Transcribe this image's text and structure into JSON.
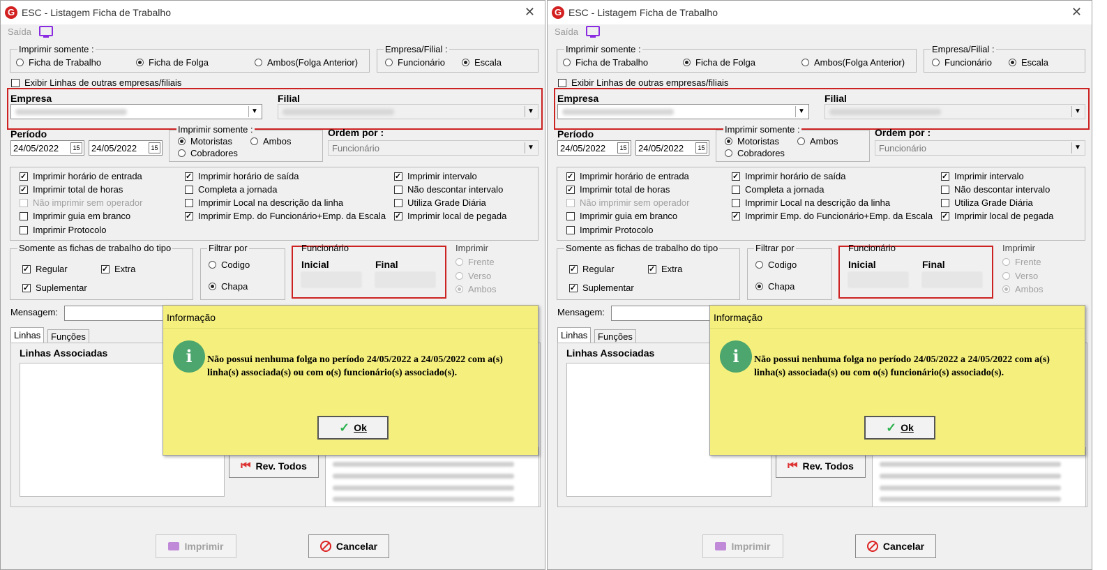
{
  "window": {
    "title": "ESC - Listagem Ficha de Trabalho",
    "logo": "G",
    "close_symbol": "✕",
    "menu_saida": "Saída"
  },
  "imprimir_somente": {
    "label": "Imprimir somente :",
    "opt1": "Ficha de Trabalho",
    "opt2": "Ficha de Folga",
    "opt3": "Ambos(Folga Anterior)",
    "selected": "Ficha de Folga"
  },
  "empresa_filial": {
    "label": "Empresa/Filial :",
    "opt1": "Funcionário",
    "opt2": "Escala",
    "selected": "Escala"
  },
  "exibir_linhas": "Exibir Linhas de outras empresas/filiais",
  "empresa_label": "Empresa",
  "filial_label": "Filial",
  "periodo": {
    "label": "Período",
    "start": "24/05/2022",
    "end": "24/05/2022",
    "cal_icon": "15"
  },
  "imprimir_somente2": {
    "label": "Imprimir somente :",
    "opt1": "Motoristas",
    "opt2": "Ambos",
    "opt3": "Cobradores",
    "selected": "Motoristas"
  },
  "ordem": {
    "label": "Ordem por :",
    "value": "Funcionário"
  },
  "checks": {
    "c1": "Imprimir horário de entrada",
    "c2": "Imprimir total de horas",
    "c3": "Não imprimir sem operador",
    "c4": "Imprimir guia em branco",
    "c5": "Imprimir Protocolo",
    "c6": "Imprimir horário de saída",
    "c7": "Completa a jornada",
    "c8": "Imprimir Local na descrição da linha",
    "c9": "Imprimir Emp. do Funcionário+Emp. da Escala",
    "c10": "Imprimir intervalo",
    "c11": "Não descontar intervalo",
    "c12": "Utiliza Grade Diária",
    "c13": "Imprimir local de pegada"
  },
  "tipo": {
    "label": "Somente as fichas de trabalho do tipo",
    "regular": "Regular",
    "extra": "Extra",
    "suplementar": "Suplementar"
  },
  "filtrar": {
    "label": "Filtrar por",
    "codigo": "Codigo",
    "chapa": "Chapa",
    "selected": "Chapa"
  },
  "funcionario": {
    "label": "Funcionário",
    "inicial": "Inicial",
    "final": "Final"
  },
  "imprimir_lado": {
    "label": "Imprimir",
    "frente": "Frente",
    "verso": "Verso",
    "ambos": "Ambos",
    "selected": "Ambos"
  },
  "mensagem_label": "Mensagem:",
  "tabs": {
    "linhas": "Linhas",
    "funcoes": "Funções"
  },
  "linhas_associadas": "Linhas Associadas",
  "rev_todos": "Rev. Todos",
  "imprimir_btn": "Imprimir",
  "cancelar_btn": "Cancelar",
  "dialog": {
    "title": "Informação",
    "icon": "i",
    "message": "Não possui nenhuma folga no período 24/05/2022 a 24/05/2022 com a(s) linha(s) associada(s) ou com o(s) funcionário(s) associado(s).",
    "ok": "Ok"
  },
  "colors": {
    "highlight_red": "#cc2222",
    "dialog_yellow": "#f5f07d",
    "info_green": "#4ca66d",
    "accent_purple": "#8a2be2"
  }
}
